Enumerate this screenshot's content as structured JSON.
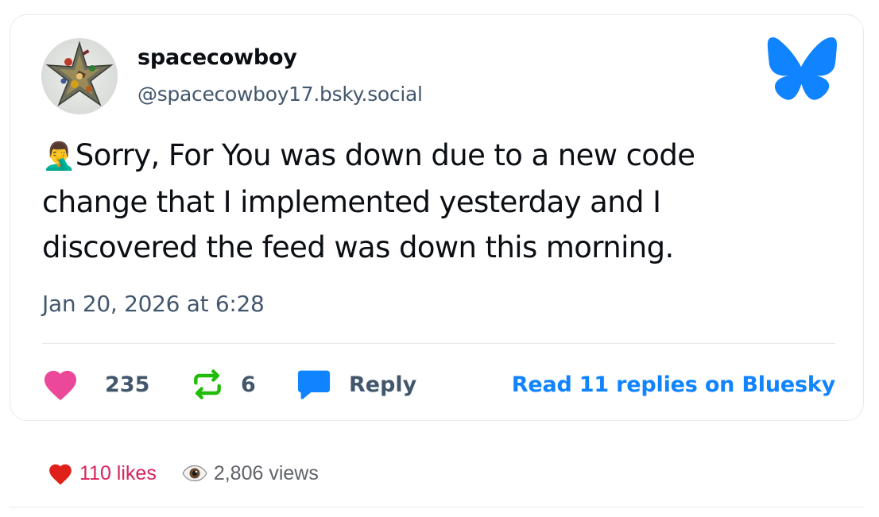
{
  "author": {
    "display_name": "spacecowboy",
    "handle": "@spacecowboy17.bsky.social",
    "avatar_icon": "avatar-star-icon"
  },
  "brand": {
    "logo_icon": "bluesky-butterfly-icon",
    "color": "#1083fe"
  },
  "post": {
    "emoji": "🤦‍♂️",
    "text": "Sorry, For You was down due to a new code change that I implemented yesterday and I discovered the feed was down this morning.",
    "timestamp": "Jan 20, 2026 at 6:28"
  },
  "actions": {
    "like_count": "235",
    "like_icon": "heart-icon",
    "like_color": "#ec4899",
    "repost_count": "6",
    "repost_icon": "repost-icon",
    "repost_color": "#20bc07",
    "reply_label": "Reply",
    "reply_icon": "speech-bubble-icon",
    "read_replies_label": "Read 11 replies on Bluesky"
  },
  "stats": {
    "likes_icon": "red-heart-icon",
    "likes_label": "110 likes",
    "views_icon": "eye-icon",
    "views_label": "2,806 views"
  }
}
